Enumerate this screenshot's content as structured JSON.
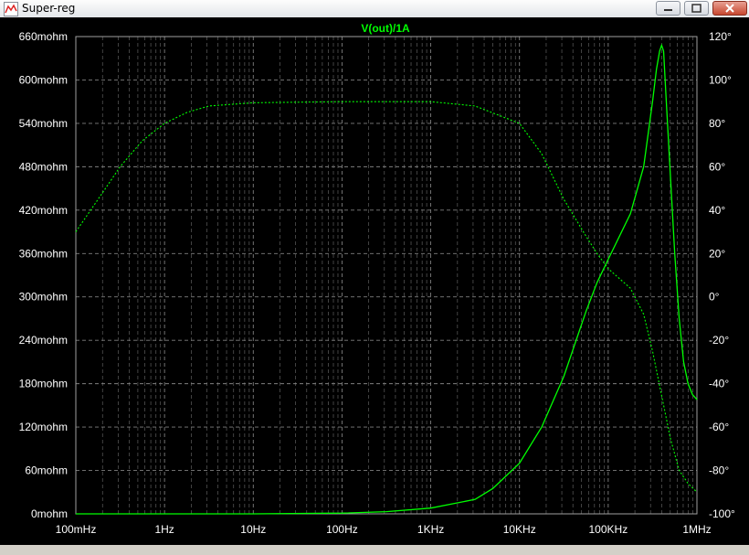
{
  "window": {
    "title": "Super-reg",
    "icons": {
      "app": "waveform-icon",
      "minimize": "minimize-icon",
      "maximize": "maximize-icon",
      "close": "close-icon"
    }
  },
  "chart_data": {
    "type": "line",
    "title": "V(out)/1A",
    "x_scale": "log",
    "xlim": [
      0.1,
      1000000
    ],
    "x_tick_labels": [
      "100mHz",
      "1Hz",
      "10Hz",
      "100Hz",
      "1KHz",
      "10KHz",
      "100KHz",
      "1MHz"
    ],
    "x_ticks": [
      0.1,
      1,
      10,
      100,
      1000,
      10000,
      100000,
      1000000
    ],
    "y_left": {
      "ylim": [
        0,
        660
      ],
      "ticks": [
        0,
        60,
        120,
        180,
        240,
        300,
        360,
        420,
        480,
        540,
        600,
        660
      ],
      "tick_labels": [
        "0mohm",
        "60mohm",
        "120mohm",
        "180mohm",
        "240mohm",
        "300mohm",
        "360mohm",
        "420mohm",
        "480mohm",
        "540mohm",
        "600mohm",
        "660mohm"
      ]
    },
    "y_right": {
      "ylim": [
        -100,
        120
      ],
      "ticks": [
        -100,
        -80,
        -60,
        -40,
        -20,
        0,
        20,
        40,
        60,
        80,
        100,
        120
      ],
      "tick_labels": [
        "-100°",
        "-80°",
        "-60°",
        "-40°",
        "-20°",
        "0°",
        "20°",
        "40°",
        "60°",
        "80°",
        "100°",
        "120°"
      ]
    },
    "grid": true,
    "colors": {
      "background": "#000000",
      "trace": "#00ff00",
      "grid": "#7f7f7f",
      "axis_text": "#ffffff",
      "title": "#00ff00"
    },
    "series": [
      {
        "kind": "magnitude",
        "axis": "left",
        "style": "solid",
        "unit": "mohm",
        "points": [
          [
            0.1,
            0
          ],
          [
            10,
            0
          ],
          [
            100,
            1
          ],
          [
            316,
            3
          ],
          [
            1000,
            8
          ],
          [
            3162,
            20
          ],
          [
            5000,
            35
          ],
          [
            10000,
            70
          ],
          [
            17800,
            120
          ],
          [
            31600,
            190
          ],
          [
            56200,
            280
          ],
          [
            75000,
            320
          ],
          [
            100000,
            352
          ],
          [
            178000,
            415
          ],
          [
            251000,
            480
          ],
          [
            316000,
            570
          ],
          [
            350000,
            615
          ],
          [
            380000,
            640
          ],
          [
            400000,
            648
          ],
          [
            421000,
            640
          ],
          [
            447000,
            580
          ],
          [
            501000,
            470
          ],
          [
            562000,
            360
          ],
          [
            631000,
            270
          ],
          [
            708000,
            210
          ],
          [
            794000,
            180
          ],
          [
            891000,
            165
          ],
          [
            1000000,
            158
          ]
        ]
      },
      {
        "kind": "phase",
        "axis": "right",
        "style": "dashed",
        "unit": "degrees",
        "points": [
          [
            0.1,
            30
          ],
          [
            0.2,
            48
          ],
          [
            0.316,
            60
          ],
          [
            0.562,
            72
          ],
          [
            1,
            80
          ],
          [
            1.78,
            85
          ],
          [
            3.16,
            88
          ],
          [
            10,
            89.5
          ],
          [
            100,
            90
          ],
          [
            1000,
            90
          ],
          [
            3162,
            88
          ],
          [
            10000,
            80
          ],
          [
            17800,
            66
          ],
          [
            31600,
            45
          ],
          [
            56200,
            28
          ],
          [
            75000,
            20
          ],
          [
            100000,
            13
          ],
          [
            178000,
            4
          ],
          [
            251000,
            -8
          ],
          [
            316000,
            -25
          ],
          [
            398000,
            -45
          ],
          [
            501000,
            -65
          ],
          [
            631000,
            -80
          ],
          [
            794000,
            -86
          ],
          [
            1000000,
            -90
          ]
        ]
      }
    ]
  }
}
